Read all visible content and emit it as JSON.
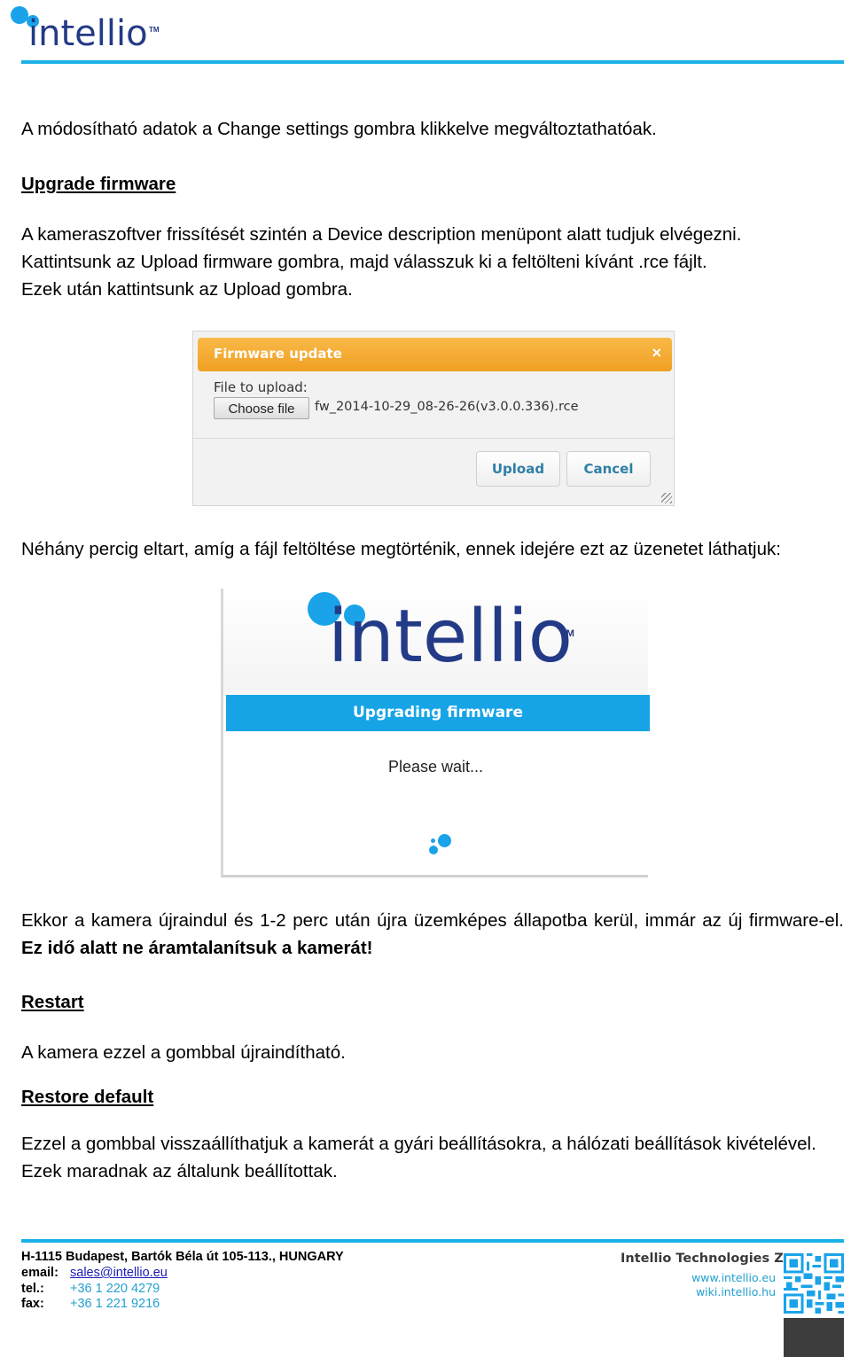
{
  "header": {
    "logo_text": "intellio",
    "logo_tm": "TM",
    "brand_color": "#1aa3e8",
    "brand_text_color": "#233a86"
  },
  "body": {
    "intro": "A módosítható adatok a Change settings gombra klikkelve megváltoztathatóak.",
    "sections": {
      "upgrade_firmware": {
        "heading": "Upgrade firmware",
        "lines": [
          "A kameraszoftver frissítését szintén a Device description menüpont alatt tudjuk elvégezni.",
          "Kattintsunk az Upload firmware gombra, majd válasszuk ki a feltölteni kívánt .rce fájlt.",
          "Ezek után kattintsunk az Upload gombra."
        ]
      },
      "waiting_paragraph": "Néhány percig eltart, amíg a fájl feltöltése megtörténik, ennek idejére ezt az üzenetet láthatjuk:",
      "after_upgrade": {
        "normal": "Ekkor a kamera újraindul és 1-2 perc után újra üzemképes állapotba kerül, immár az új firmware-el. ",
        "bold": "Ez idő alatt ne áramtalanítsuk a kamerát!"
      },
      "restart": {
        "heading": "Restart",
        "text": "A kamera ezzel a gombbal újraindítható."
      },
      "restore_default": {
        "heading": "Restore default",
        "text": "Ezzel a gombbal visszaállíthatjuk a kamerát a gyári beállításokra, a hálózati beállítások kivételével. Ezek maradnak az általunk beállítottak."
      }
    }
  },
  "firmware_dialog": {
    "title": "Firmware update",
    "close_glyph": "×",
    "file_label": "File to upload:",
    "choose_file_label": "Choose file",
    "file_name": "fw_2014-10-29_08-26-26(v3.0.0.336).rce",
    "upload_label": "Upload",
    "cancel_label": "Cancel",
    "title_color": "#f5a623",
    "button_text_color": "#2e7fa6"
  },
  "upgrading_screen": {
    "logo_text": "intellio",
    "logo_tm": "TM",
    "banner": "Upgrading firmware",
    "message": "Please wait...",
    "banner_color": "#17a4e6"
  },
  "footer": {
    "address": "H-1115 Budapest, Bartók Béla út 105-113., HUNGARY",
    "email_label": "email:",
    "email": "sales@intellio.eu",
    "tel_label": "tel.:",
    "tel": "+36 1 220 4279",
    "fax_label": "fax:",
    "fax": "+36 1 221 9216",
    "company": "Intellio Technologies Zrt.",
    "website": "www.intellio.eu",
    "wiki": "wiki.intellio.hu",
    "qr_icon": "qr-code"
  }
}
